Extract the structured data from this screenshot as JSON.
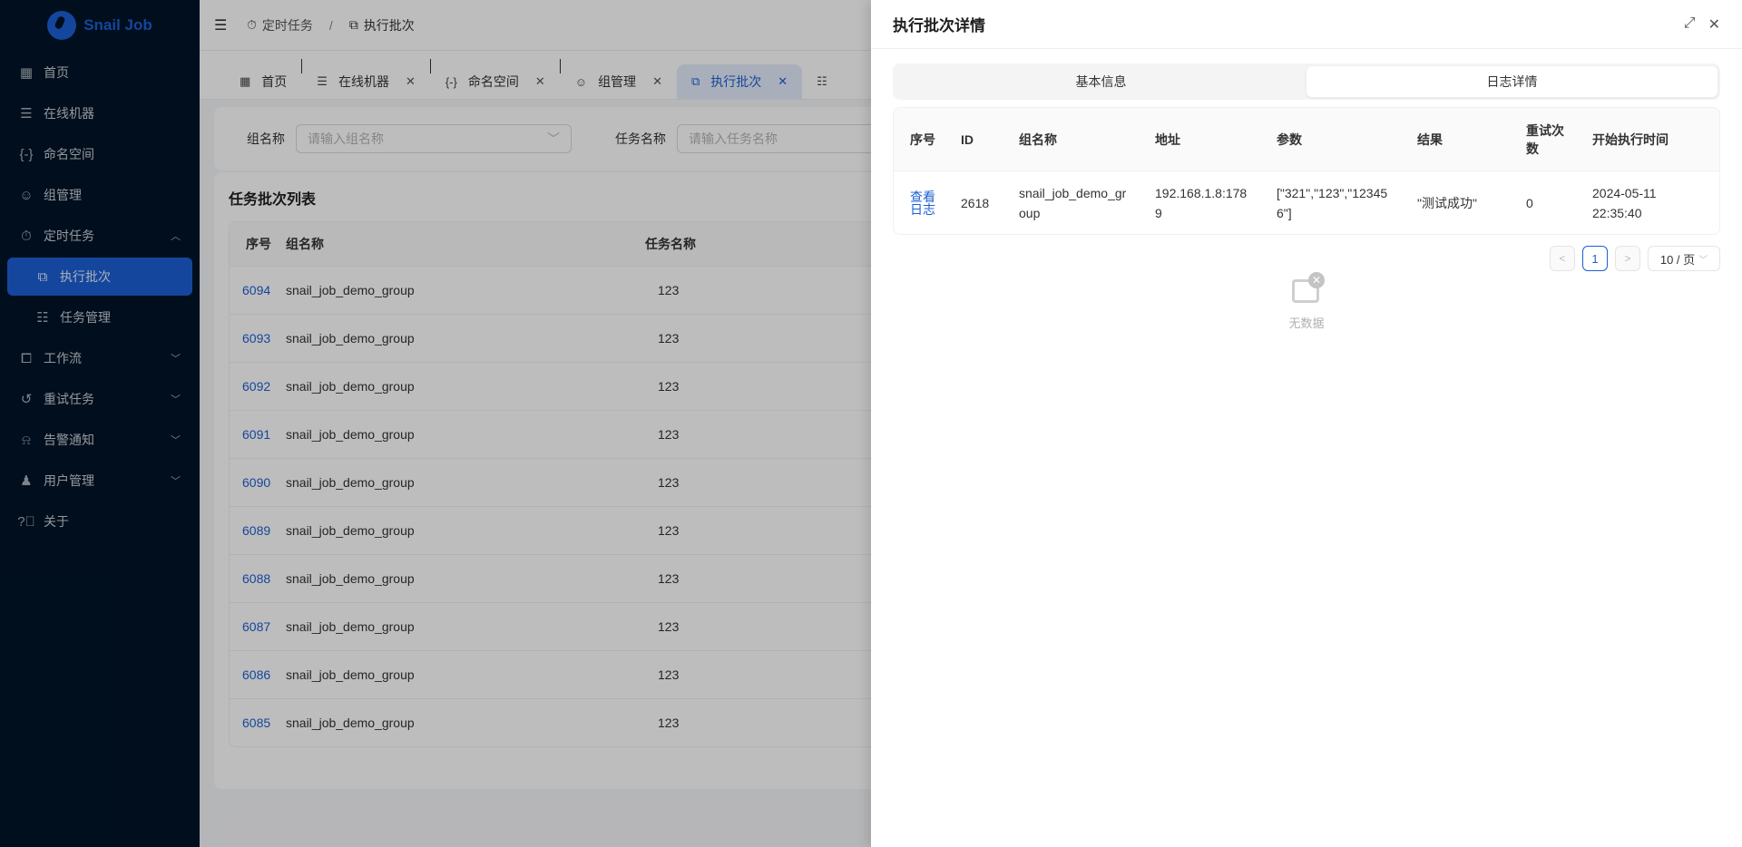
{
  "app": {
    "name": "Snail Job"
  },
  "sidebar": {
    "items": [
      {
        "label": "首页",
        "icon": "dashboard-icon"
      },
      {
        "label": "在线机器",
        "icon": "server-icon"
      },
      {
        "label": "命名空间",
        "icon": "namespace-icon"
      },
      {
        "label": "组管理",
        "icon": "group-icon"
      },
      {
        "label": "定时任务",
        "icon": "timer-icon",
        "expanded": true
      },
      {
        "label": "执行批次",
        "icon": "batch-icon",
        "active": true
      },
      {
        "label": "任务管理",
        "icon": "task-list-icon"
      },
      {
        "label": "工作流",
        "icon": "workflow-icon"
      },
      {
        "label": "重试任务",
        "icon": "retry-icon"
      },
      {
        "label": "告警通知",
        "icon": "alarm-icon"
      },
      {
        "label": "用户管理",
        "icon": "user-settings-icon"
      },
      {
        "label": "关于",
        "icon": "help-icon"
      }
    ]
  },
  "header": {
    "breadcrumb": [
      "定时任务",
      "执行批次"
    ],
    "separator": "/"
  },
  "tabs": [
    {
      "label": "首页"
    },
    {
      "label": "在线机器"
    },
    {
      "label": "命名空间"
    },
    {
      "label": "组管理"
    },
    {
      "label": "执行批次",
      "active": true
    }
  ],
  "search": {
    "group_label": "组名称",
    "group_placeholder": "请输入组名称",
    "task_label": "任务名称",
    "task_placeholder": "请输入任务名称"
  },
  "list": {
    "title": "任务批次列表",
    "columns": [
      "序号",
      "组名称",
      "任务名称"
    ],
    "rows": [
      {
        "id": "6094",
        "group": "snail_job_demo_group",
        "task": "123"
      },
      {
        "id": "6093",
        "group": "snail_job_demo_group",
        "task": "123"
      },
      {
        "id": "6092",
        "group": "snail_job_demo_group",
        "task": "123"
      },
      {
        "id": "6091",
        "group": "snail_job_demo_group",
        "task": "123"
      },
      {
        "id": "6090",
        "group": "snail_job_demo_group",
        "task": "123"
      },
      {
        "id": "6089",
        "group": "snail_job_demo_group",
        "task": "123"
      },
      {
        "id": "6088",
        "group": "snail_job_demo_group",
        "task": "123"
      },
      {
        "id": "6087",
        "group": "snail_job_demo_group",
        "task": "123"
      },
      {
        "id": "6086",
        "group": "snail_job_demo_group",
        "task": "123"
      },
      {
        "id": "6085",
        "group": "snail_job_demo_group",
        "task": "123"
      }
    ]
  },
  "drawer": {
    "title": "执行批次详情",
    "segments": [
      {
        "label": "基本信息"
      },
      {
        "label": "日志详情",
        "active": true
      }
    ],
    "columns": [
      "序号",
      "ID",
      "组名称",
      "地址",
      "参数",
      "结果",
      "重试次数",
      "开始执行时间"
    ],
    "rows": [
      {
        "action": "查看日志",
        "id": "2618",
        "group": "snail_job_demo_group",
        "address": "192.168.1.8:1789",
        "params": "[\"321\",\"123\",\"123456\"]",
        "result": "\"测试成功\"",
        "retry": "0",
        "start_time": "2024-05-11 22:35:40"
      }
    ],
    "pagination": {
      "prev": "<",
      "current": "1",
      "next": ">",
      "page_size": "10 / 页"
    },
    "empty_text": "无数据"
  }
}
